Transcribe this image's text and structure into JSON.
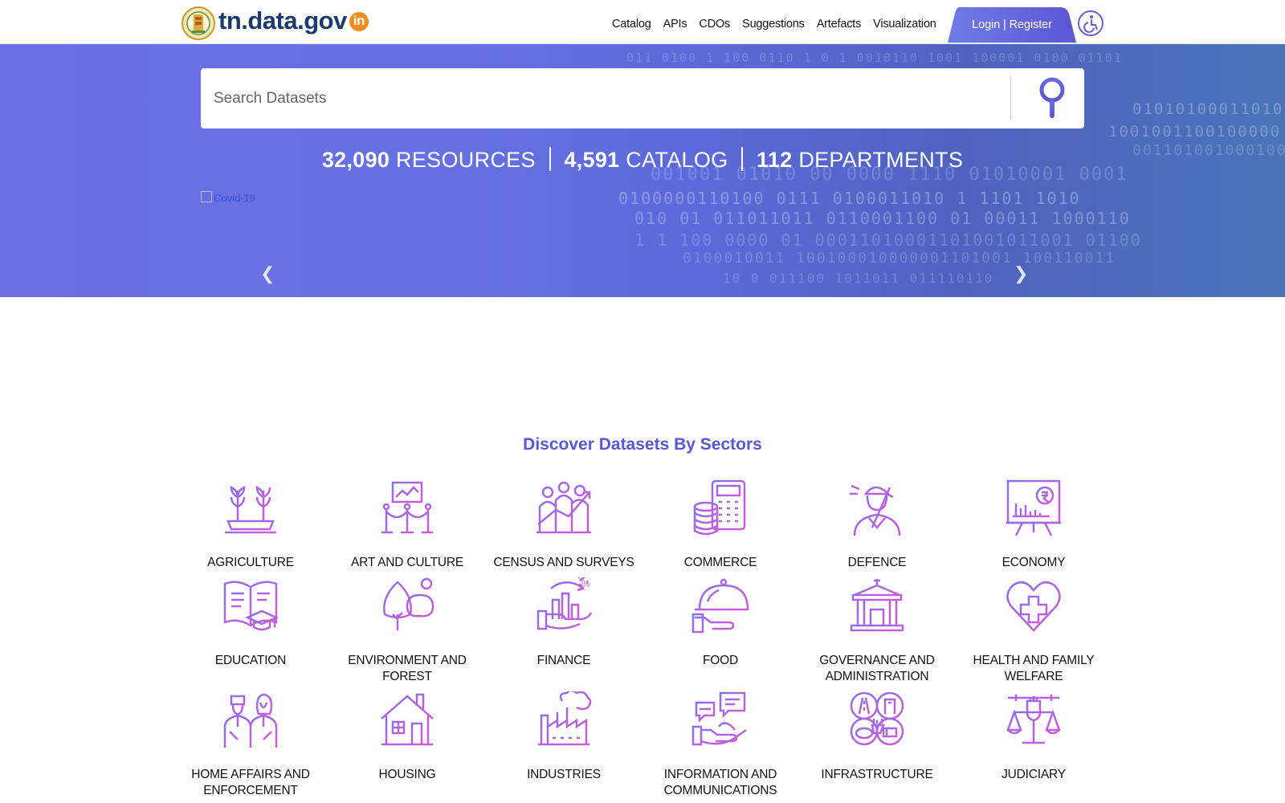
{
  "header": {
    "brand": "tn.data.gov",
    "brand_suffix": "in",
    "nav": [
      "Catalog",
      "APIs",
      "CDOs",
      "Suggestions",
      "Artefacts",
      "Visualization"
    ],
    "login_label": "Login | Register",
    "accessibility_icon": "accessibility-icon"
  },
  "hero": {
    "search_placeholder": "Search Datasets",
    "stats": [
      {
        "value": "32,090",
        "label": "RESOURCES"
      },
      {
        "value": "4,591",
        "label": "CATALOG"
      },
      {
        "value": "112",
        "label": "DEPARTMENTS"
      }
    ],
    "banner_alt": "Covid-19"
  },
  "sectors": {
    "title": "Discover Datasets By Sectors",
    "items": [
      "AGRICULTURE",
      "ART AND CULTURE",
      "CENSUS AND SURVEYS",
      "COMMERCE",
      "DEFENCE",
      "ECONOMY",
      "EDUCATION",
      "ENVIRONMENT AND FOREST",
      "FINANCE",
      "FOOD",
      "GOVERNANCE AND ADMINISTRATION",
      "HEALTH AND FAMILY WELFARE",
      "HOME AFFAIRS AND ENFORCEMENT",
      "HOUSING",
      "INDUSTRIES",
      "INFORMATION AND COMMUNICATIONS",
      "INFRASTRUCTURE",
      "JUDICIARY"
    ]
  },
  "colors": {
    "accent": "#5a57d6",
    "icon_gradient_start": "#8a6ff0",
    "icon_gradient_end": "#d35ad8",
    "hero": "#6670e3"
  }
}
